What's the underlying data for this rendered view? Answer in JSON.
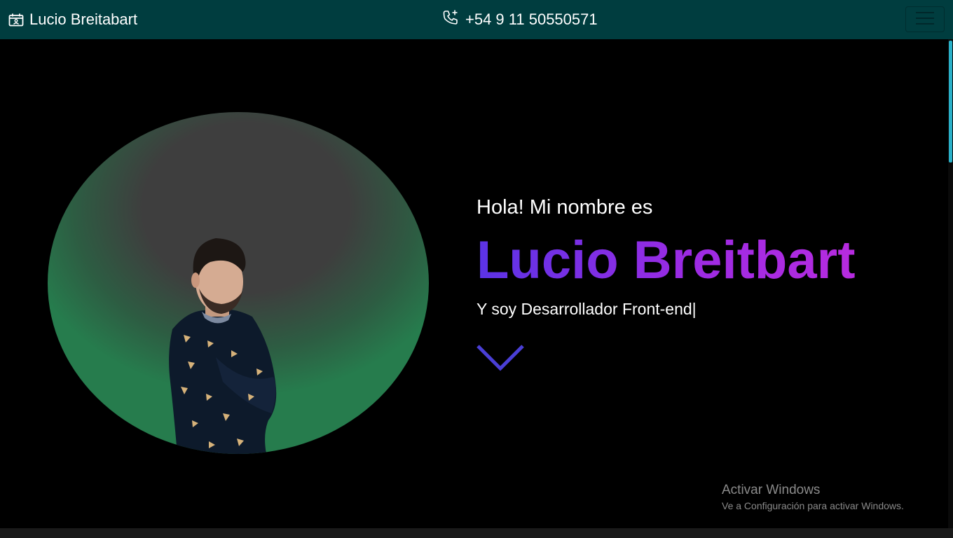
{
  "navbar": {
    "brand_icon": "calendar-contact-icon",
    "brand": "Lucio Breitabart",
    "phone_icon": "phone-plus-icon",
    "phone": "+54 9 11 50550571",
    "menu_icon": "hamburger-icon",
    "background": "#003d3f"
  },
  "hero": {
    "greeting": "Hola! Mi nombre es",
    "name": "Lucio Breitbart",
    "role": "Y soy Desarrollador Front-end|",
    "scroll_icon": "chevron-down-icon",
    "name_gradient": [
      "#5b33e6",
      "#b72be0"
    ],
    "avatar_colors": [
      "#3e3e3e",
      "#267c4d"
    ]
  },
  "watermark": {
    "title": "Activar Windows",
    "subtitle": "Ve a Configuración para activar Windows."
  }
}
